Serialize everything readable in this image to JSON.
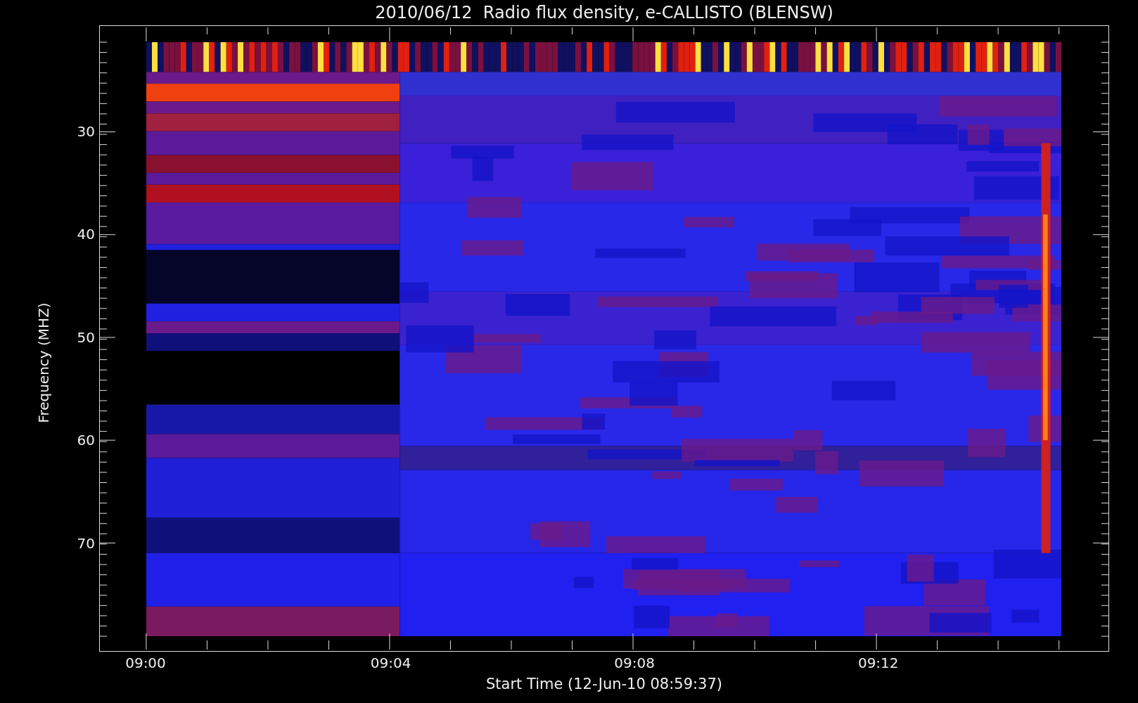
{
  "chart": {
    "title": "2010/06/12  Radio flux density, e-CALLISTO (BLENSW)",
    "ylabel": "Frequency (MHZ)",
    "yticks": [
      "30",
      "40",
      "50",
      "60",
      "70"
    ],
    "xticks": [
      "09:00",
      "09:04",
      "09:08",
      "09:12"
    ],
    "xlabel": "Start Time (12-Jun-10 08:59:37)"
  }
}
